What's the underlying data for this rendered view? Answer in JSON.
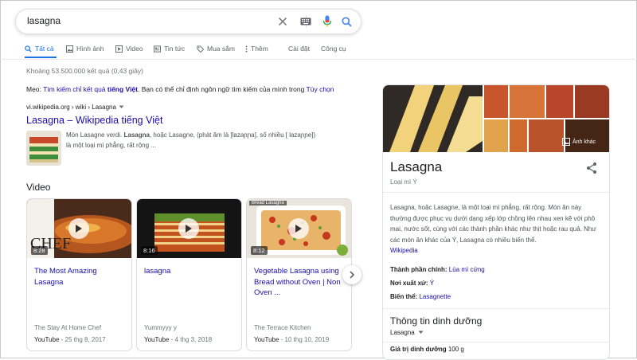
{
  "search": {
    "query": "lasagna",
    "icons": [
      "clear-icon",
      "keyboard-icon",
      "mic-icon",
      "search-icon"
    ]
  },
  "tabs": [
    {
      "label": "Tất cả",
      "icon": "search-icon",
      "active": true
    },
    {
      "label": "Hình ảnh",
      "icon": "image-icon"
    },
    {
      "label": "Video",
      "icon": "video-icon"
    },
    {
      "label": "Tin tức",
      "icon": "news-icon"
    },
    {
      "label": "Mua sắm",
      "icon": "tag-icon"
    },
    {
      "label": "Thêm",
      "icon": "more-icon"
    },
    {
      "label": "Cài đặt"
    },
    {
      "label": "Công cụ"
    }
  ],
  "stats": "Khoảng 53.500.000 kết quả (0,43 giây)",
  "tip": {
    "prefix": "Mẹo: ",
    "link": "Tìm kiếm chỉ kết quả ",
    "bold": "tiếng Việt",
    "middle": ". Bạn có thể chỉ định ngôn ngữ tìm kiếm của mình trong ",
    "link2": "Tùy chọn"
  },
  "result": {
    "cite": "vi.wikipedia.org › wiki › Lasagna",
    "title": "Lasagna – Wikipedia tiếng Việt",
    "snippet_a": "Món Lasagne verdi. ",
    "snippet_b": "Lasagna",
    "snippet_c": ", hoặc Lasagne, (phát âm là [lazaɲɲa], số nhiều [ lazaɲɲe]) là một loại mì phẳng, rất rộng ..."
  },
  "video_heading": "Video",
  "videos": [
    {
      "title": "The Most Amazing Lasagna",
      "duration": "8:28",
      "channel": "The Stay At Home Chef",
      "source": "YouTube",
      "date": " - 25 thg 8, 2017"
    },
    {
      "title": "lasagna",
      "duration": "8:16",
      "channel": "Yummyyy y",
      "source": "YouTube",
      "date": " - 4 thg 3, 2018"
    },
    {
      "title": "Vegetable Lasagna using Bread without Oven | Non Oven ...",
      "duration": "8:12",
      "channel": "The Terrace Kitchen",
      "source": "YouTube",
      "date": " - 10 thg 10, 2019",
      "thumb_label": "Bread Lasagna"
    }
  ],
  "knowledge_panel": {
    "more_images": "Ảnh khác",
    "title": "Lasagna",
    "subtitle": "Loại mì Ý",
    "description": "Lasagna, hoặc Lasagne, là một loại mì phẳng, rất rộng. Món ăn này thường được phục vụ dưới dạng xếp lớp chồng lên nhau xen kẽ với phô mai, nước sốt, cùng với các thành phần khác như thịt hoặc rau quả. Như các món ăn khác của Ý, Lasagna có nhiều biến thể.",
    "source_link": "Wikipedia",
    "facts": [
      {
        "label": "Thành phần chính:",
        "value": "Lúa mì cứng"
      },
      {
        "label": "Nơi xuất xứ:",
        "value": "Ý"
      },
      {
        "label": "Biến thể:",
        "value": "Lasagnette"
      }
    ],
    "nutrition_heading": "Thông tin dinh dưỡng",
    "nutrition_select": "Lasagna",
    "nutrition_row_label": "Giá trị dinh dưỡng",
    "nutrition_row_value": " 100 g"
  },
  "colors": {
    "link": "#1a0dab",
    "accent": "#1a73e8",
    "text": "#202124",
    "muted": "#70757a"
  }
}
